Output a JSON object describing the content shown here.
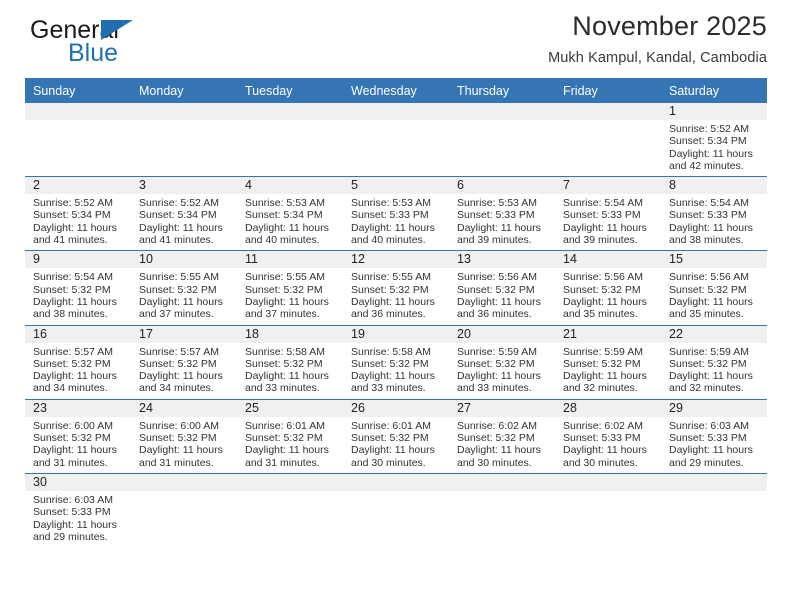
{
  "brand": {
    "name_part1": "General",
    "name_part2": "Blue",
    "colors": {
      "blue": "#1f6fb2",
      "black": "#1a1a1a"
    }
  },
  "header": {
    "title": "November 2025",
    "subtitle": "Mukh Kampul, Kandal, Cambodia"
  },
  "theme": {
    "header_blue": "#3575b4",
    "daynum_band": "#f0f0f0",
    "grid_line": "#3575b4"
  },
  "weekdays": [
    "Sunday",
    "Monday",
    "Tuesday",
    "Wednesday",
    "Thursday",
    "Friday",
    "Saturday"
  ],
  "weeks": [
    [
      {
        "empty": true
      },
      {
        "empty": true
      },
      {
        "empty": true
      },
      {
        "empty": true
      },
      {
        "empty": true
      },
      {
        "empty": true
      },
      {
        "day": "1",
        "sunrise": "Sunrise: 5:52 AM",
        "sunset": "Sunset: 5:34 PM",
        "daylight1": "Daylight: 11 hours",
        "daylight2": "and 42 minutes."
      }
    ],
    [
      {
        "day": "2",
        "sunrise": "Sunrise: 5:52 AM",
        "sunset": "Sunset: 5:34 PM",
        "daylight1": "Daylight: 11 hours",
        "daylight2": "and 41 minutes."
      },
      {
        "day": "3",
        "sunrise": "Sunrise: 5:52 AM",
        "sunset": "Sunset: 5:34 PM",
        "daylight1": "Daylight: 11 hours",
        "daylight2": "and 41 minutes."
      },
      {
        "day": "4",
        "sunrise": "Sunrise: 5:53 AM",
        "sunset": "Sunset: 5:34 PM",
        "daylight1": "Daylight: 11 hours",
        "daylight2": "and 40 minutes."
      },
      {
        "day": "5",
        "sunrise": "Sunrise: 5:53 AM",
        "sunset": "Sunset: 5:33 PM",
        "daylight1": "Daylight: 11 hours",
        "daylight2": "and 40 minutes."
      },
      {
        "day": "6",
        "sunrise": "Sunrise: 5:53 AM",
        "sunset": "Sunset: 5:33 PM",
        "daylight1": "Daylight: 11 hours",
        "daylight2": "and 39 minutes."
      },
      {
        "day": "7",
        "sunrise": "Sunrise: 5:54 AM",
        "sunset": "Sunset: 5:33 PM",
        "daylight1": "Daylight: 11 hours",
        "daylight2": "and 39 minutes."
      },
      {
        "day": "8",
        "sunrise": "Sunrise: 5:54 AM",
        "sunset": "Sunset: 5:33 PM",
        "daylight1": "Daylight: 11 hours",
        "daylight2": "and 38 minutes."
      }
    ],
    [
      {
        "day": "9",
        "sunrise": "Sunrise: 5:54 AM",
        "sunset": "Sunset: 5:32 PM",
        "daylight1": "Daylight: 11 hours",
        "daylight2": "and 38 minutes."
      },
      {
        "day": "10",
        "sunrise": "Sunrise: 5:55 AM",
        "sunset": "Sunset: 5:32 PM",
        "daylight1": "Daylight: 11 hours",
        "daylight2": "and 37 minutes."
      },
      {
        "day": "11",
        "sunrise": "Sunrise: 5:55 AM",
        "sunset": "Sunset: 5:32 PM",
        "daylight1": "Daylight: 11 hours",
        "daylight2": "and 37 minutes."
      },
      {
        "day": "12",
        "sunrise": "Sunrise: 5:55 AM",
        "sunset": "Sunset: 5:32 PM",
        "daylight1": "Daylight: 11 hours",
        "daylight2": "and 36 minutes."
      },
      {
        "day": "13",
        "sunrise": "Sunrise: 5:56 AM",
        "sunset": "Sunset: 5:32 PM",
        "daylight1": "Daylight: 11 hours",
        "daylight2": "and 36 minutes."
      },
      {
        "day": "14",
        "sunrise": "Sunrise: 5:56 AM",
        "sunset": "Sunset: 5:32 PM",
        "daylight1": "Daylight: 11 hours",
        "daylight2": "and 35 minutes."
      },
      {
        "day": "15",
        "sunrise": "Sunrise: 5:56 AM",
        "sunset": "Sunset: 5:32 PM",
        "daylight1": "Daylight: 11 hours",
        "daylight2": "and 35 minutes."
      }
    ],
    [
      {
        "day": "16",
        "sunrise": "Sunrise: 5:57 AM",
        "sunset": "Sunset: 5:32 PM",
        "daylight1": "Daylight: 11 hours",
        "daylight2": "and 34 minutes."
      },
      {
        "day": "17",
        "sunrise": "Sunrise: 5:57 AM",
        "sunset": "Sunset: 5:32 PM",
        "daylight1": "Daylight: 11 hours",
        "daylight2": "and 34 minutes."
      },
      {
        "day": "18",
        "sunrise": "Sunrise: 5:58 AM",
        "sunset": "Sunset: 5:32 PM",
        "daylight1": "Daylight: 11 hours",
        "daylight2": "and 33 minutes."
      },
      {
        "day": "19",
        "sunrise": "Sunrise: 5:58 AM",
        "sunset": "Sunset: 5:32 PM",
        "daylight1": "Daylight: 11 hours",
        "daylight2": "and 33 minutes."
      },
      {
        "day": "20",
        "sunrise": "Sunrise: 5:59 AM",
        "sunset": "Sunset: 5:32 PM",
        "daylight1": "Daylight: 11 hours",
        "daylight2": "and 33 minutes."
      },
      {
        "day": "21",
        "sunrise": "Sunrise: 5:59 AM",
        "sunset": "Sunset: 5:32 PM",
        "daylight1": "Daylight: 11 hours",
        "daylight2": "and 32 minutes."
      },
      {
        "day": "22",
        "sunrise": "Sunrise: 5:59 AM",
        "sunset": "Sunset: 5:32 PM",
        "daylight1": "Daylight: 11 hours",
        "daylight2": "and 32 minutes."
      }
    ],
    [
      {
        "day": "23",
        "sunrise": "Sunrise: 6:00 AM",
        "sunset": "Sunset: 5:32 PM",
        "daylight1": "Daylight: 11 hours",
        "daylight2": "and 31 minutes."
      },
      {
        "day": "24",
        "sunrise": "Sunrise: 6:00 AM",
        "sunset": "Sunset: 5:32 PM",
        "daylight1": "Daylight: 11 hours",
        "daylight2": "and 31 minutes."
      },
      {
        "day": "25",
        "sunrise": "Sunrise: 6:01 AM",
        "sunset": "Sunset: 5:32 PM",
        "daylight1": "Daylight: 11 hours",
        "daylight2": "and 31 minutes."
      },
      {
        "day": "26",
        "sunrise": "Sunrise: 6:01 AM",
        "sunset": "Sunset: 5:32 PM",
        "daylight1": "Daylight: 11 hours",
        "daylight2": "and 30 minutes."
      },
      {
        "day": "27",
        "sunrise": "Sunrise: 6:02 AM",
        "sunset": "Sunset: 5:32 PM",
        "daylight1": "Daylight: 11 hours",
        "daylight2": "and 30 minutes."
      },
      {
        "day": "28",
        "sunrise": "Sunrise: 6:02 AM",
        "sunset": "Sunset: 5:33 PM",
        "daylight1": "Daylight: 11 hours",
        "daylight2": "and 30 minutes."
      },
      {
        "day": "29",
        "sunrise": "Sunrise: 6:03 AM",
        "sunset": "Sunset: 5:33 PM",
        "daylight1": "Daylight: 11 hours",
        "daylight2": "and 29 minutes."
      }
    ],
    [
      {
        "day": "30",
        "sunrise": "Sunrise: 6:03 AM",
        "sunset": "Sunset: 5:33 PM",
        "daylight1": "Daylight: 11 hours",
        "daylight2": "and 29 minutes."
      },
      {
        "empty": true
      },
      {
        "empty": true
      },
      {
        "empty": true
      },
      {
        "empty": true
      },
      {
        "empty": true
      },
      {
        "empty": true
      }
    ]
  ]
}
